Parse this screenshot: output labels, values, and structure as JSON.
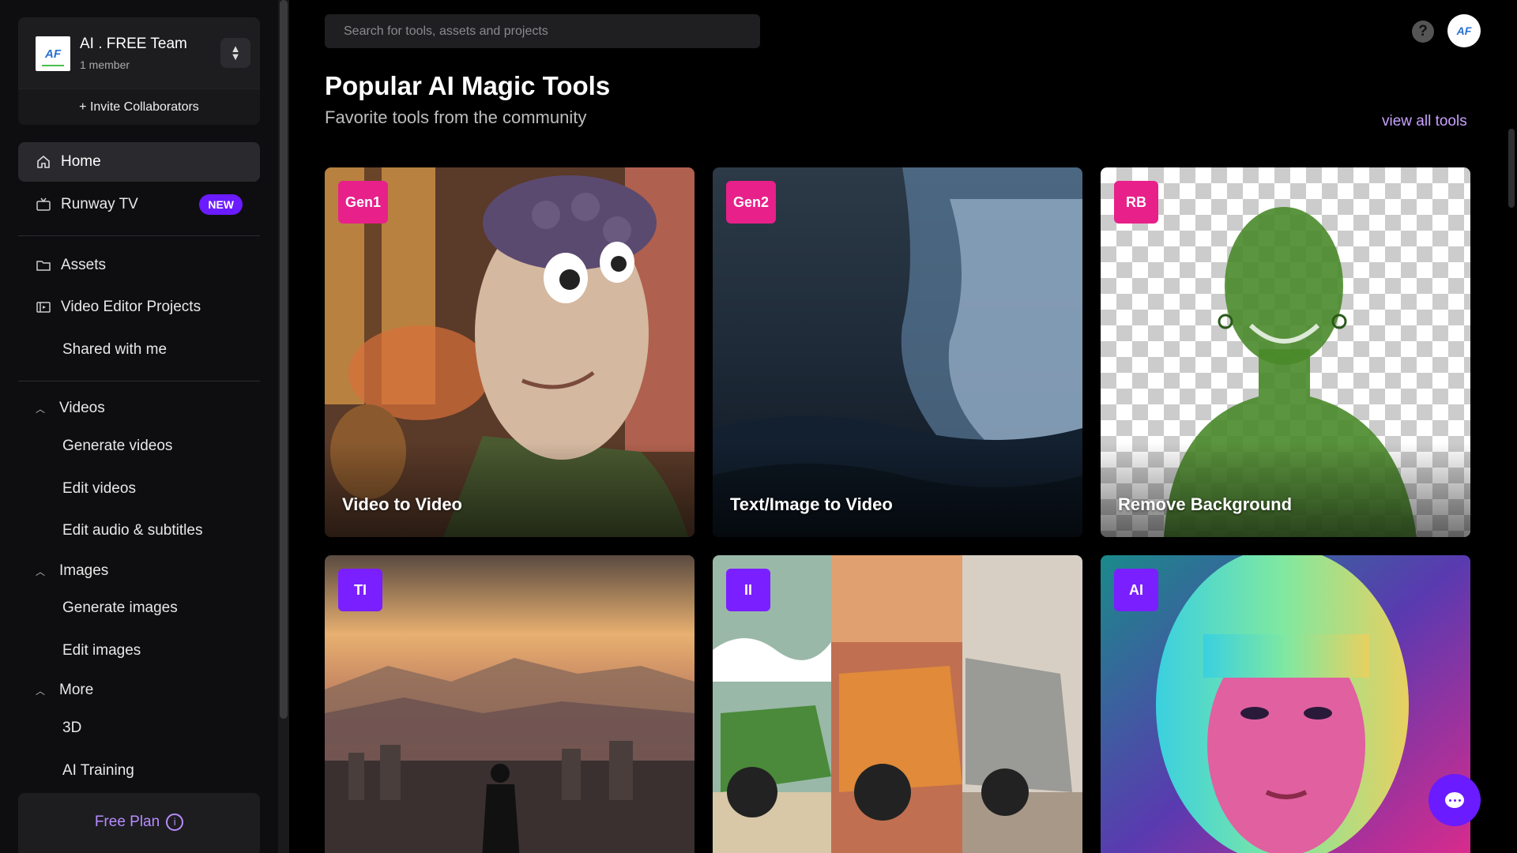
{
  "team": {
    "logo_text": "AF",
    "name": "AI . FREE Team",
    "members": "1 member",
    "invite_label": "+ Invite Collaborators"
  },
  "nav": {
    "home": "Home",
    "runway_tv": "Runway TV",
    "new_badge": "NEW",
    "assets": "Assets",
    "video_editor": "Video Editor Projects",
    "shared": "Shared with me"
  },
  "sections": {
    "videos": {
      "label": "Videos",
      "items": [
        "Generate videos",
        "Edit videos",
        "Edit audio & subtitles"
      ]
    },
    "images": {
      "label": "Images",
      "items": [
        "Generate images",
        "Edit images"
      ]
    },
    "more": {
      "label": "More",
      "items": [
        "3D",
        "AI Training"
      ]
    }
  },
  "plan": {
    "label": "Free Plan"
  },
  "search": {
    "placeholder": "Search for tools, assets and projects"
  },
  "header": {
    "avatar_text": "AF"
  },
  "main": {
    "title": "Popular AI Magic Tools",
    "subtitle": "Favorite tools from the community",
    "view_all": "view all tools"
  },
  "cards": [
    {
      "tag": "Gen1",
      "title": "Video to Video",
      "tag_color": "#e8208a"
    },
    {
      "tag": "Gen2",
      "title": "Text/Image to Video",
      "tag_color": "#e8208a"
    },
    {
      "tag": "RB",
      "title": "Remove Background",
      "tag_color": "#e8208a"
    },
    {
      "tag": "TI",
      "title": "",
      "tag_color": "#7a1fff"
    },
    {
      "tag": "II",
      "title": "",
      "tag_color": "#7a1fff"
    },
    {
      "tag": "AI",
      "title": "",
      "tag_color": "#7a1fff"
    }
  ],
  "colors": {
    "accent_purple": "#6a1bff",
    "tag_pink": "#e8208a",
    "tag_violet": "#7a1fff",
    "link": "#c7a1ff"
  }
}
